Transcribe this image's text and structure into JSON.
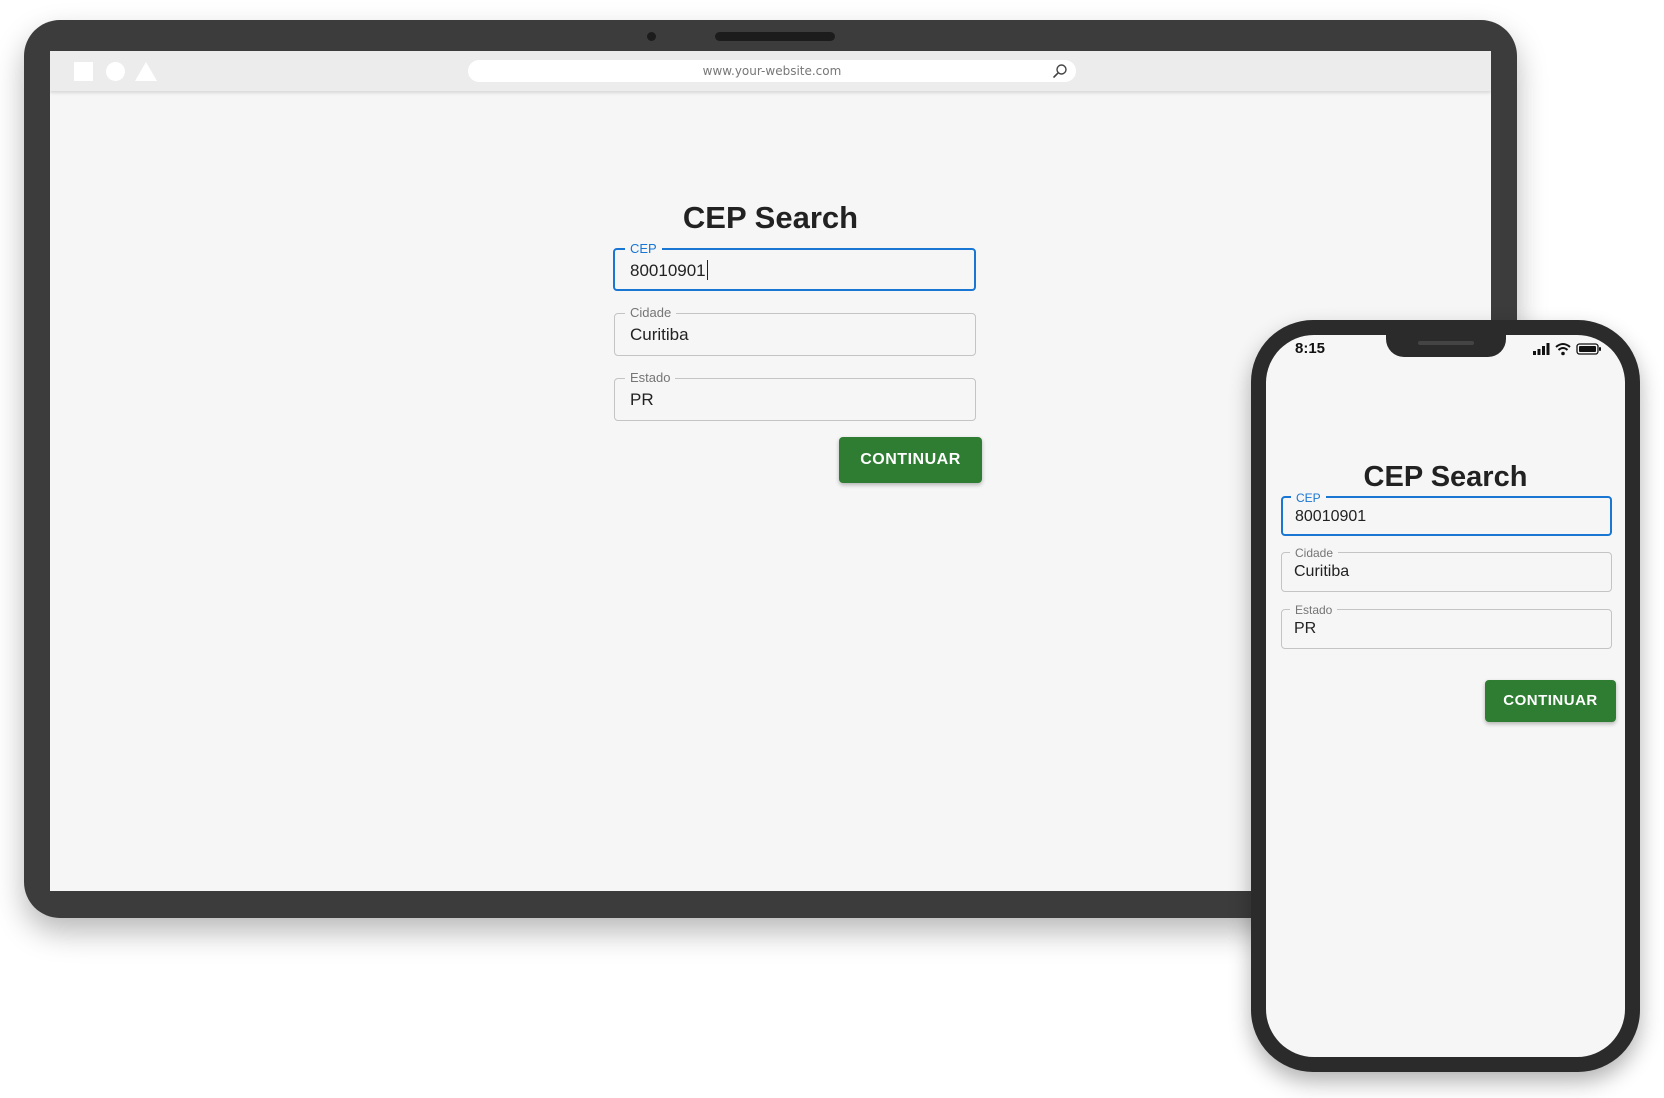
{
  "browser": {
    "url": "www.your-website.com"
  },
  "desktop": {
    "title": "CEP Search",
    "fields": [
      {
        "label": "CEP",
        "value": "80010901",
        "focused": true
      },
      {
        "label": "Cidade",
        "value": "Curitiba",
        "focused": false
      },
      {
        "label": "Estado",
        "value": "PR",
        "focused": false
      }
    ],
    "button_label": "CONTINUAR"
  },
  "mobile": {
    "status_time": "8:15",
    "title": "CEP Search",
    "fields": [
      {
        "label": "CEP",
        "value": "80010901",
        "focused": true
      },
      {
        "label": "Cidade",
        "value": "Curitiba",
        "focused": false
      },
      {
        "label": "Estado",
        "value": "PR",
        "focused": false
      }
    ],
    "button_label": "CONTINUAR"
  },
  "colors": {
    "accent": "#1976d2",
    "button": "#2e7d32",
    "background": "#f6f6f6",
    "device_frame": "#3c3c3c"
  },
  "icons": [
    "square-icon",
    "circle-icon",
    "triangle-icon",
    "search-icon",
    "signal-icon",
    "wifi-icon",
    "battery-icon"
  ]
}
